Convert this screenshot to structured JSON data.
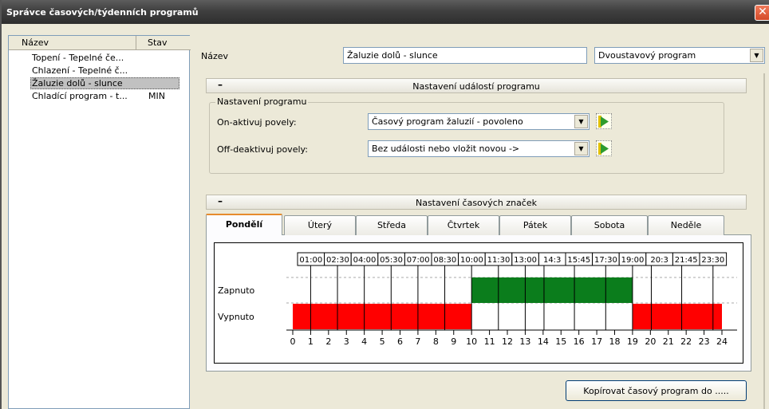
{
  "window": {
    "title": "Správce časových/týdenních programů",
    "close_glyph": "✕"
  },
  "list": {
    "headers": {
      "name": "Název",
      "state": "Stav"
    },
    "rows": [
      {
        "name": "Topení - Tepelné če...",
        "state": ""
      },
      {
        "name": "Chlazení - Tepelné č...",
        "state": ""
      },
      {
        "name": "Žaluzie dolů - slunce",
        "state": "",
        "selected": true
      },
      {
        "name": "Chladící program - t...",
        "state": "MIN"
      }
    ]
  },
  "form": {
    "name_label": "Název",
    "name_value": "Žaluzie dolů - slunce",
    "type_value": "Dvoustavový program"
  },
  "events_section": {
    "title": "Nastavení událostí programu",
    "collapse_glyph": "–",
    "group_title": "Nastavení programu",
    "on_label": "On-aktivuj povely:",
    "on_value": "Časový program žaluzií - povoleno",
    "off_label": "Off-deaktivuj povely:",
    "off_value": "Bez události nebo vložit novou ->"
  },
  "time_section": {
    "title": "Nastavení časových značek",
    "collapse_glyph": "–"
  },
  "days": [
    "Pondělí",
    "Úterý",
    "Středa",
    "Čtvrtek",
    "Pátek",
    "Sobota",
    "Neděle"
  ],
  "active_day": 0,
  "chart_data": {
    "type": "step",
    "state_labels": {
      "on": "Zapnuto",
      "off": "Vypnuto"
    },
    "time_marks": [
      "01:00",
      "02:30",
      "04:00",
      "05:30",
      "07:00",
      "08:30",
      "10:00",
      "11:30",
      "13:00",
      "14:3",
      "15:45",
      "17:30",
      "19:00",
      "20:3",
      "21:45",
      "23:30"
    ],
    "hour_ticks": [
      0,
      1,
      2,
      3,
      4,
      5,
      6,
      7,
      8,
      9,
      10,
      11,
      12,
      13,
      14,
      15,
      16,
      17,
      18,
      19,
      20,
      21,
      22,
      23,
      24
    ],
    "off_intervals": [
      [
        0,
        10
      ],
      [
        19,
        24
      ]
    ],
    "on_intervals": [
      [
        10,
        19
      ]
    ],
    "colors": {
      "on": "#0b7d1c",
      "off": "#ff0000"
    }
  },
  "copy_button": "Kopírovat časový program do ....."
}
